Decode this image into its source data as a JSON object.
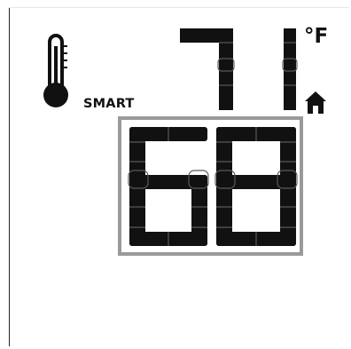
{
  "thermostat": {
    "current_temperature": "71",
    "temperature_unit": "°F",
    "setpoint_temperature": "68",
    "mode_label": "SMART",
    "icons": [
      "thermometer-icon",
      "home-icon"
    ],
    "colors": {
      "segment": "#111111",
      "setpoint_box": "#9a9a9a",
      "background": "#ffffff"
    }
  }
}
